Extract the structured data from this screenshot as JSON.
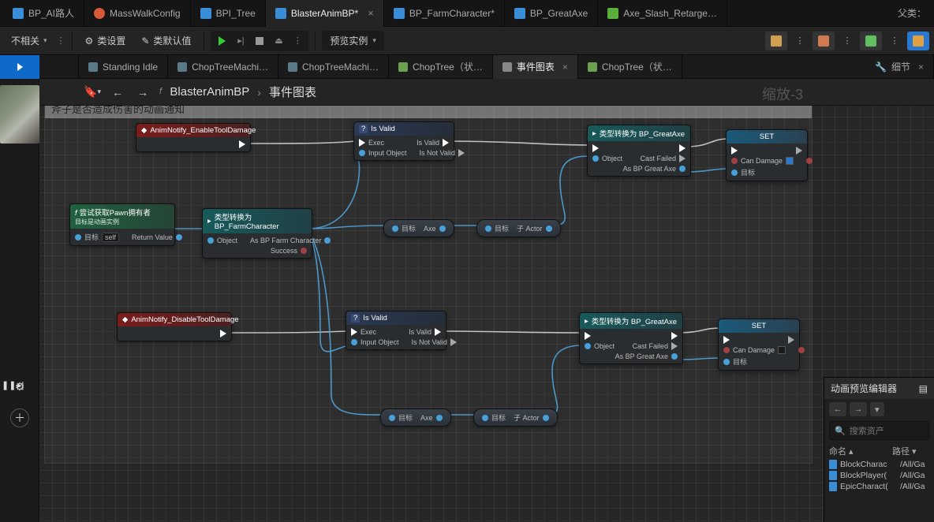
{
  "topTabs": [
    {
      "label": "BP_AI路人",
      "iconColor": "#3a8ed8"
    },
    {
      "label": "MassWalkConfig",
      "iconColor": "#d85a3a"
    },
    {
      "label": "BPI_Tree",
      "iconColor": "#3a8ed8"
    },
    {
      "label": "BlasterAnimBP*",
      "iconColor": "#3a8ed8",
      "active": true,
      "closable": true
    },
    {
      "label": "BP_FarmCharacter*",
      "iconColor": "#3a8ed8"
    },
    {
      "label": "BP_GreatAxe",
      "iconColor": "#3a8ed8"
    },
    {
      "label": "Axe_Slash_Retarge…",
      "iconColor": "#5ab03a"
    }
  ],
  "parentClassLabel": "父类：",
  "toolbar": {
    "unrelated": "不相关",
    "classSettings": "类设置",
    "classDefaults": "类默认值",
    "previewInstance": "预览实例"
  },
  "subTabs": [
    {
      "label": "Standing Idle"
    },
    {
      "label": "ChopTreeMachi…"
    },
    {
      "label": "ChopTreeMachi…"
    },
    {
      "label": "ChopTree（状…"
    },
    {
      "label": "事件图表",
      "active": true,
      "closable": true
    },
    {
      "label": "ChopTree（状…"
    }
  ],
  "detailsTab": "细节",
  "breadcrumb": {
    "parent": "BlasterAnimBP",
    "current": "事件图表"
  },
  "zoomLabel": "缩放-3",
  "commentTitle": "斧子是否造成伤害的动画通知",
  "nodes": {
    "enableNotify": "AnimNotify_EnableToolDamage",
    "disableNotify": "AnimNotify_DisableToolDamage",
    "tryGetPawn": {
      "title": "尝试获取Pawn拥有者",
      "subtitle": "目标是动画实例",
      "target": "目标",
      "self": "self",
      "ret": "Return Value"
    },
    "castFarm": {
      "title": "类型转换为 BP_FarmCharacter",
      "object": "Object",
      "asFarm": "As BP Farm Character",
      "success": "Success"
    },
    "isValid": {
      "title": "Is Valid",
      "exec": "Exec",
      "input": "Input Object",
      "valid": "Is Valid",
      "notValid": "Is Not Valid"
    },
    "castAxe": {
      "title": "类型转换为 BP_GreatAxe",
      "object": "Object",
      "castFailed": "Cast Failed",
      "asAxe": "As BP Great Axe"
    },
    "set": {
      "title": "SET",
      "canDamage": "Can Damage",
      "target": "目标"
    },
    "compact": {
      "target": "目标",
      "axe": "Axe",
      "child": "子 Actor"
    }
  },
  "rightPanel": {
    "title": "动画预览编辑器",
    "searchPlaceholder": "搜索资产",
    "colName": "命名",
    "colPath": "路径",
    "items": [
      {
        "name": "BlockCharac",
        "path": "/All/Ga"
      },
      {
        "name": "BlockPlayer(",
        "path": "/All/Ga"
      },
      {
        "name": "EpicCharact(",
        "path": "/All/Ga"
      }
    ]
  }
}
